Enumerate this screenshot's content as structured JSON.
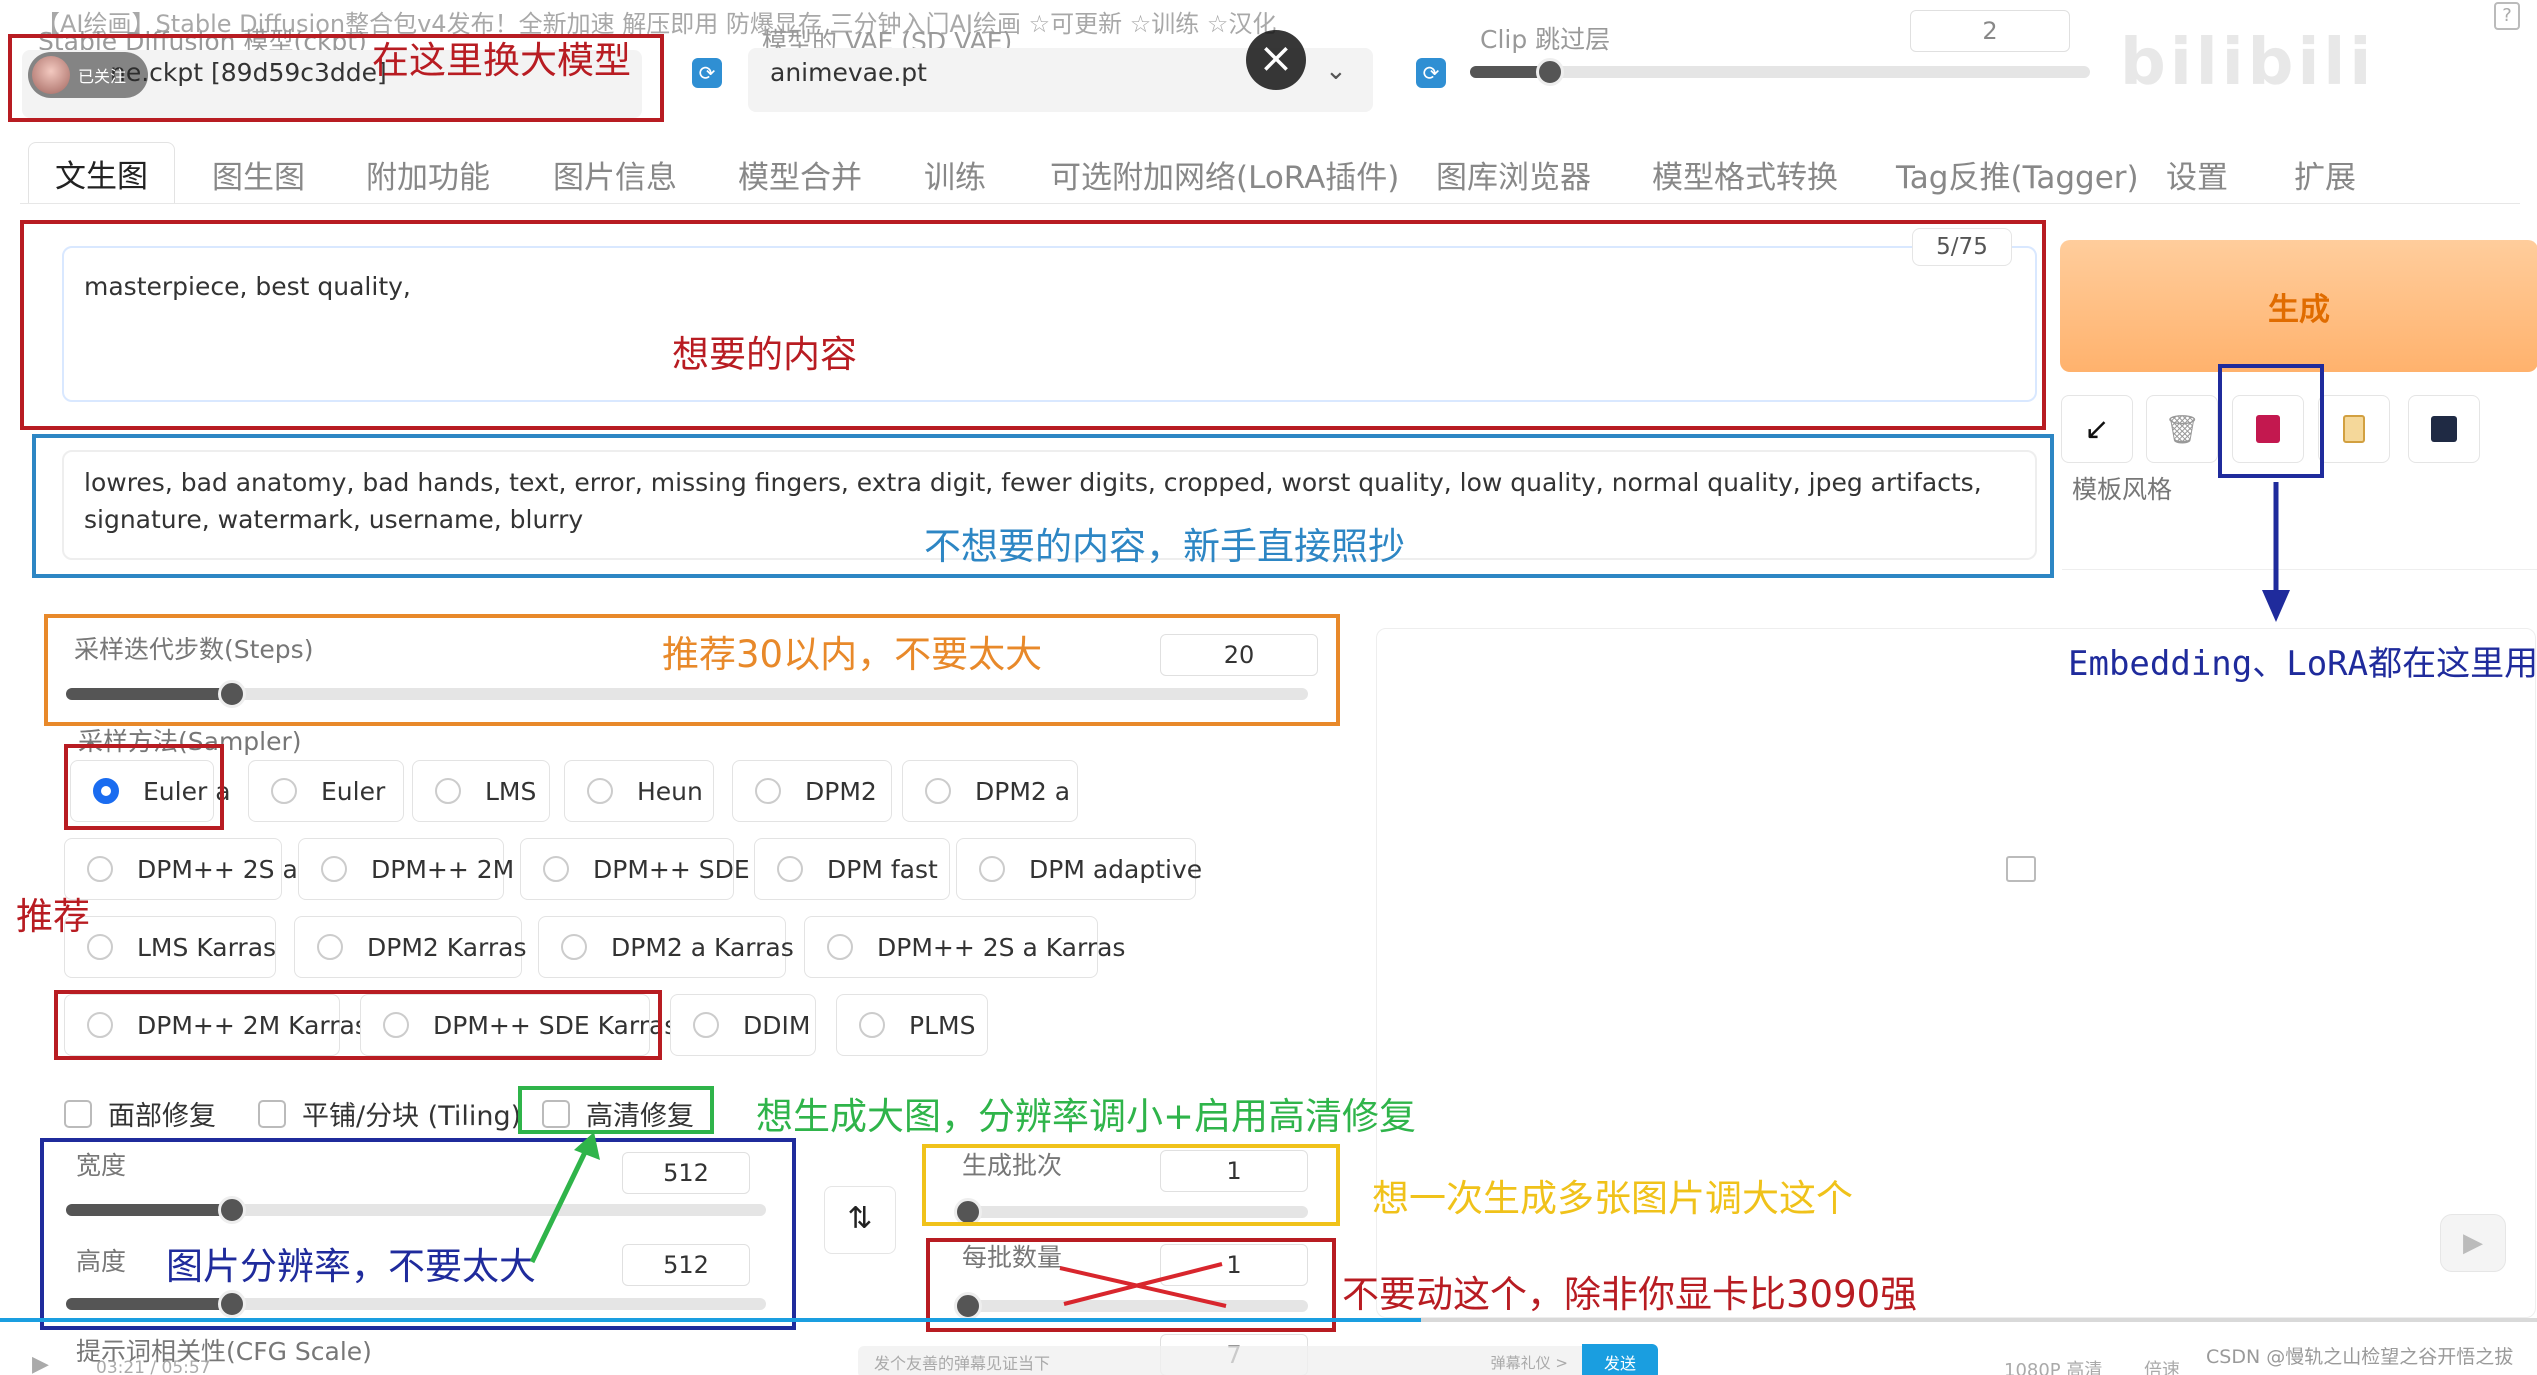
{
  "video_title": "【AI绘画】Stable Diffusion整合包v4发布！全新加速 解压即用 防爆显存 三分钟入门AI绘画 ☆可更新 ☆训练 ☆汉化",
  "follow_badge": "已关注",
  "top": {
    "ckpt_label": "Stable Diffusion 模型(ckpt)",
    "ckpt_value": "anything-v4.5-pruned-fp16-animeme.ckpt [89d59c3dde]",
    "ckpt_value_visible": "ne.ckpt [89d59c3dde]",
    "vae_label": "模型的 VAE (SD VAE)",
    "vae_value": "animevae.pt",
    "clip_label": "Clip 跳过层",
    "clip_value": "2",
    "clip_level": 0.12
  },
  "tabs": [
    "文生图",
    "图生图",
    "附加功能",
    "图片信息",
    "模型合并",
    "训练",
    "可选附加网络(LoRA插件)",
    "图库浏览器",
    "模型格式转换",
    "Tag反推(Tagger)",
    "设置",
    "扩展"
  ],
  "prompt": {
    "counter": "5/75",
    "positive": "masterpiece, best quality,",
    "negative": "lowres, bad anatomy, bad hands, text, error, missing fingers, extra digit, fewer digits, cropped, worst quality, low quality, normal quality, jpeg artifacts, signature, watermark, username, blurry"
  },
  "generate_label": "生成",
  "style_label": "模板风格",
  "steps": {
    "label": "采样迭代步数(Steps)",
    "value": "20",
    "level": 0.13
  },
  "sampler": {
    "label": "采样方法(Sampler)",
    "selected": "Euler a",
    "options": [
      "Euler a",
      "Euler",
      "LMS",
      "Heun",
      "DPM2",
      "DPM2 a",
      "DPM++ 2S a",
      "DPM++ 2M",
      "DPM++ SDE",
      "DPM fast",
      "DPM adaptive",
      "LMS Karras",
      "DPM2 Karras",
      "DPM2 a Karras",
      "DPM++ 2S a Karras",
      "DPM++ 2M Karras",
      "DPM++ SDE Karras",
      "DDIM",
      "PLMS"
    ]
  },
  "checks": {
    "face": "面部修复",
    "tiling": "平铺/分块 (Tiling)",
    "hires": "高清修复"
  },
  "width": {
    "label": "宽度",
    "value": "512",
    "level": 0.23
  },
  "height": {
    "label": "高度",
    "value": "512",
    "level": 0.23
  },
  "batch_count": {
    "label": "生成批次",
    "value": "1",
    "level": 0.0
  },
  "batch_size": {
    "label": "每批数量",
    "value": "1",
    "level": 0.0
  },
  "cfg": {
    "label": "提示词相关性(CFG Scale)",
    "value": "7"
  },
  "annotations": {
    "model": "在这里换大模型",
    "positive": "想要的内容",
    "negative": "不想要的内容，新手直接照抄",
    "steps": "推荐30以内，不要太大",
    "recommend": "推荐",
    "hires": "想生成大图，分辨率调小+启用高清修复",
    "resolution": "图片分辨率，不要太大",
    "batch_count": "想一次生成多张图片调大这个",
    "batch_size": "不要动这个，除非你显卡比3090强",
    "embedding": "Embedding、LoRA都在这里用"
  },
  "player": {
    "time": "03:21 / 05:57",
    "danmaku_placeholder": "发个友善的弹幕见证当下",
    "danmaku_etiquette": "弹幕礼仪 >",
    "send": "发送",
    "quality": "1080P 高清",
    "speed": "倍速",
    "watermark": "CSDN @慢轨之山检望之谷开悟之拔"
  },
  "colors": {
    "red": "#b81c22",
    "blue_anno": "#2d86c4",
    "orange": "#e8892a",
    "navy": "#1f2b9c",
    "green": "#2fb44a",
    "yellow": "#f0c21a",
    "accent": "#1a6cf0"
  }
}
